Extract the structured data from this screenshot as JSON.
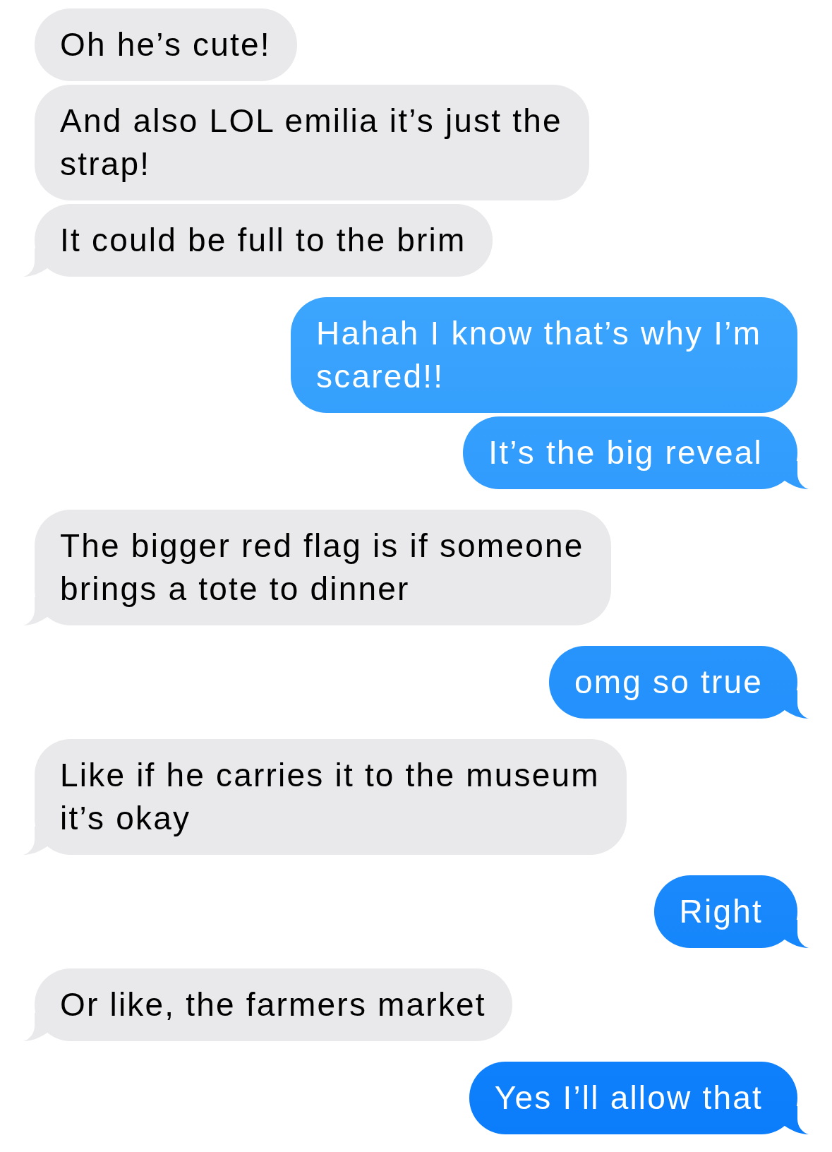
{
  "messages": [
    {
      "kind": "received",
      "tail": false,
      "text": "Oh he’s cute!"
    },
    {
      "kind": "received",
      "tail": false,
      "text": "And also LOL emilia it’s just the strap!"
    },
    {
      "kind": "received",
      "tail": true,
      "text": "It could be full to the brim"
    },
    {
      "kind": "sent",
      "tail": false,
      "text": "Hahah I know that’s why I’m scared!!"
    },
    {
      "kind": "sent",
      "tail": true,
      "text": "It’s the big reveal"
    },
    {
      "kind": "received",
      "tail": true,
      "text": "The bigger red flag is if someone brings a tote to dinner"
    },
    {
      "kind": "sent",
      "tail": true,
      "text": "omg so true"
    },
    {
      "kind": "received",
      "tail": true,
      "text": "Like if he carries it to the museum it’s okay"
    },
    {
      "kind": "sent",
      "tail": true,
      "text": "Right"
    },
    {
      "kind": "received",
      "tail": true,
      "text": "Or like, the farmers market"
    },
    {
      "kind": "sent",
      "tail": true,
      "text": "Yes I’ll allow that"
    }
  ]
}
